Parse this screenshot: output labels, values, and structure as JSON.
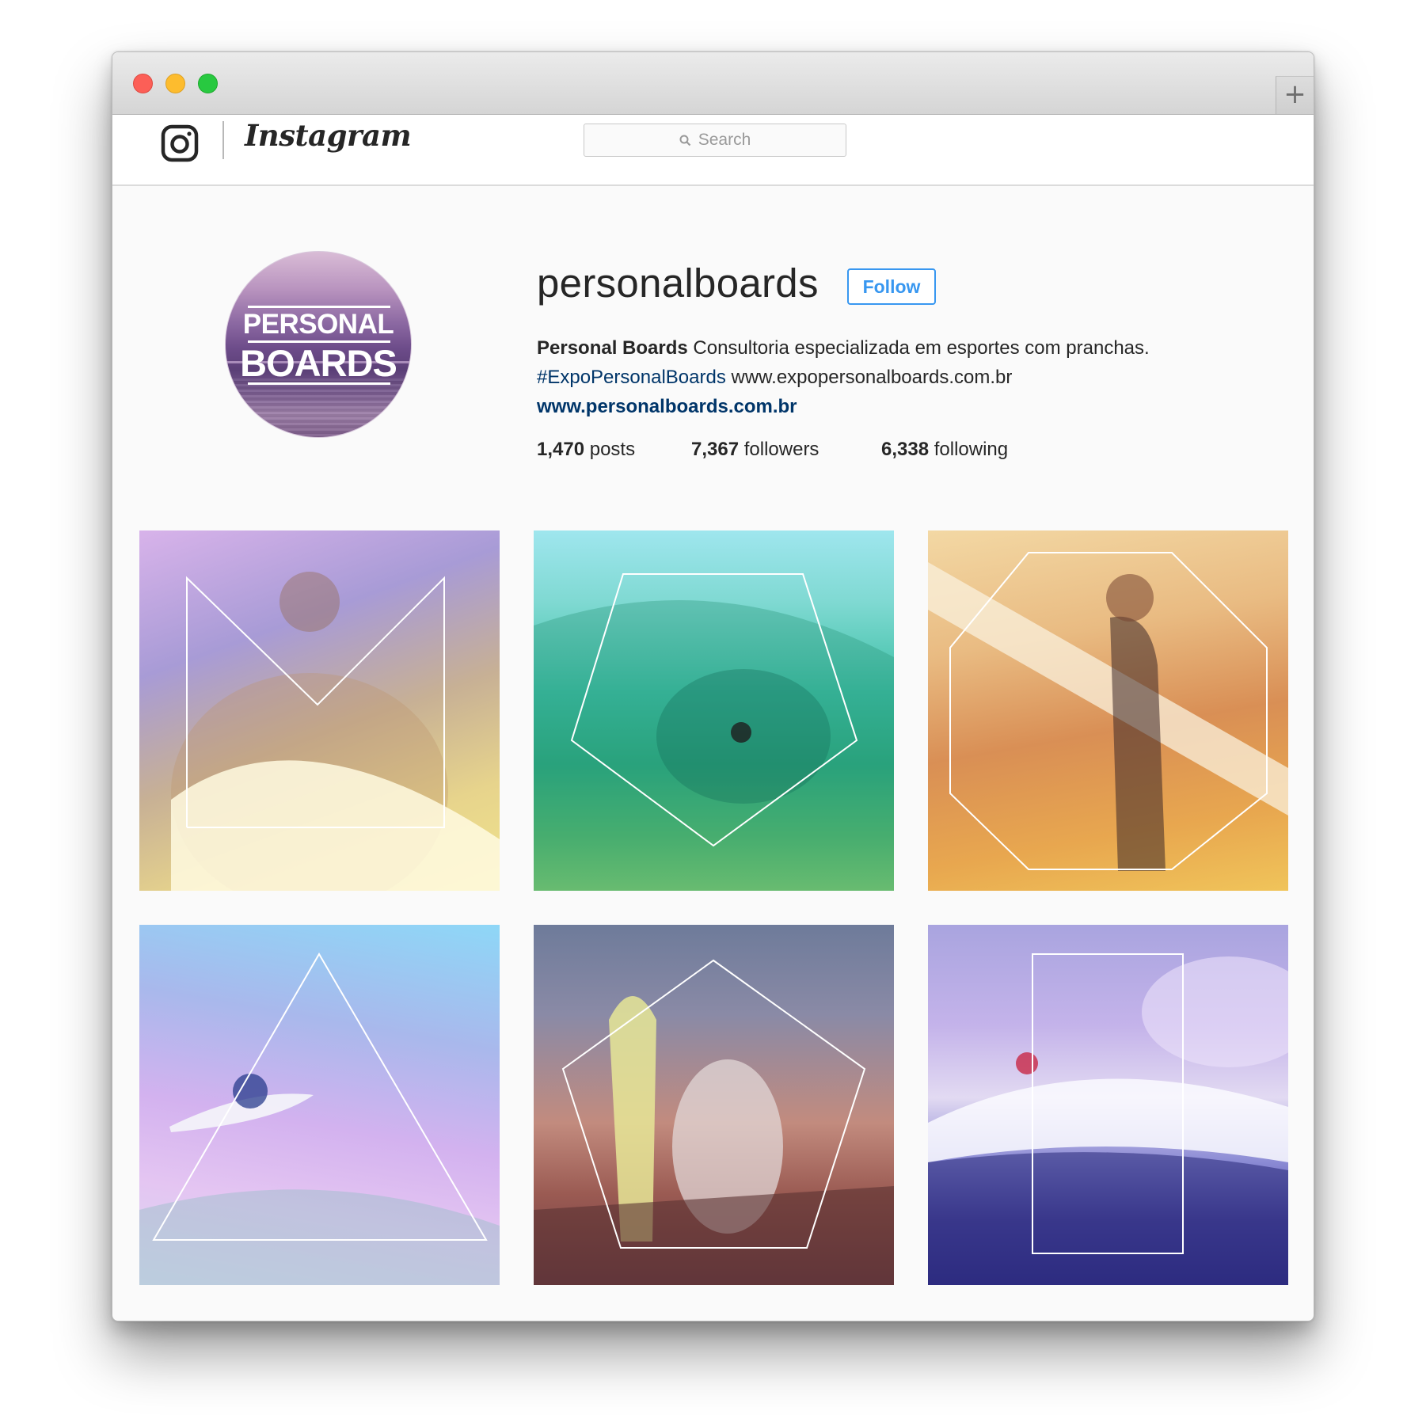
{
  "window": {
    "traffic_lights": [
      "close",
      "minimize",
      "zoom"
    ],
    "new_tab_label": "+"
  },
  "header": {
    "brand_icon": "instagram-camera-icon",
    "wordmark": "Instagram",
    "search": {
      "placeholder": "Search",
      "icon": "search-icon"
    }
  },
  "profile": {
    "avatar": {
      "line1": "PERSONAL",
      "line2": "BOARDS"
    },
    "username": "personalboards",
    "follow_label": "Follow",
    "bio": {
      "full_name": "Personal Boards",
      "description": " Consultoria especializada em esportes com pranchas.",
      "hashtag": "#ExpoPersonalBoards",
      "hashtag_suffix": " www.expopersonalboards.com.br",
      "website": "www.personalboards.com.br"
    },
    "stats": [
      {
        "value": "1,470",
        "label": " posts"
      },
      {
        "value": "7,367",
        "label": " followers"
      },
      {
        "value": "6,338",
        "label": " following"
      }
    ]
  },
  "grid": {
    "posts": [
      {
        "overlay_shape": "m-shape"
      },
      {
        "overlay_shape": "pentagon"
      },
      {
        "overlay_shape": "octagon"
      },
      {
        "overlay_shape": "triangle"
      },
      {
        "overlay_shape": "pentagon"
      },
      {
        "overlay_shape": "rectangle"
      }
    ]
  },
  "colors": {
    "accent_blue": "#3897f0",
    "link_blue": "#003569",
    "text": "#262626",
    "window_bg": "#fafafa",
    "close": "#fc5f57",
    "minimize": "#fdbc2e",
    "zoom": "#28c940"
  }
}
